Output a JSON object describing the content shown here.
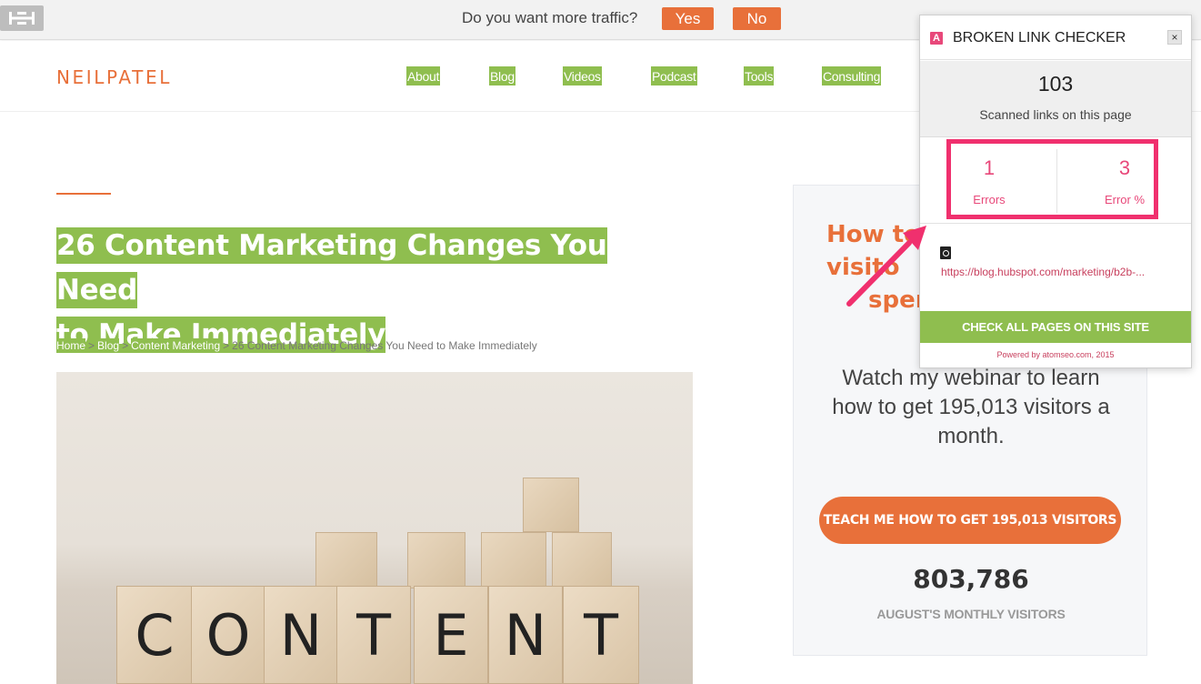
{
  "traffic_bar": {
    "question": "Do you want more traffic?",
    "yes_label": "Yes",
    "no_label": "No"
  },
  "header": {
    "logo": "NEILPATEL",
    "nav": [
      "About",
      "Blog",
      "Videos",
      "Podcast",
      "Tools",
      "Consulting"
    ]
  },
  "article": {
    "title_line1": "26 Content Marketing Changes You Need",
    "title_line2": "to Make Immediately",
    "breadcrumb": {
      "home": "Home",
      "blog": "Blog",
      "category": "Content Marketing",
      "current": "26 Content Marketing Changes You Need to Make Immediately"
    },
    "hero_letters": [
      "C",
      "O",
      "N",
      "T",
      "E",
      "N",
      "T"
    ]
  },
  "sidebar": {
    "heading_line1": "How to",
    "heading_line2": "visito",
    "heading_line3": "sper",
    "text": "Watch my webinar to learn how to get 195,013 visitors a month.",
    "cta_label": "TEACH ME HOW TO GET 195,013 VISITORS",
    "visitors_count": "803,786",
    "visitors_label": "AUGUST'S MONTHLY VISITORS"
  },
  "broken_link_checker": {
    "logo_letter": "A",
    "title": "BROKEN LINK CHECKER",
    "close_label": "×",
    "scanned_count": "103",
    "scanned_label": "Scanned links on this page",
    "errors_count": "1",
    "errors_label": "Errors",
    "error_pct": "3",
    "error_pct_label": "Error %",
    "broken_link": "https://blog.hubspot.com/marketing/b2b-...",
    "check_all_label": "CHECK ALL PAGES ON THIS SITE",
    "powered_by": "Powered by atomseo.com, 2015"
  },
  "colors": {
    "brand_orange": "#e8703a",
    "highlight_green": "#8fbe4f",
    "error_pink": "#e8487a",
    "annotation_pink": "#f0306e"
  }
}
